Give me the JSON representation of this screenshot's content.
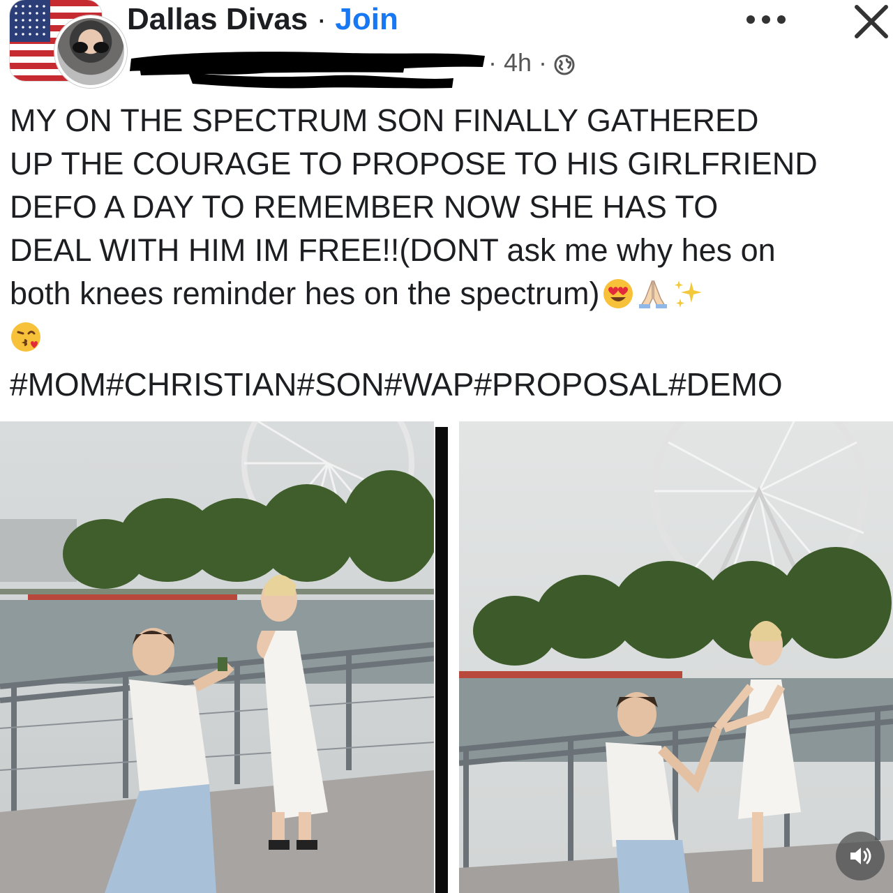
{
  "header": {
    "group_name": "Dallas Divas",
    "separator": " · ",
    "join_label": "Join",
    "time": "· 4h ·"
  },
  "post": {
    "body": "MY ON THE SPECTRUM SON FINALLY GATHERED\nUP THE COURAGE TO PROPOSE TO HIS GIRLFRIEND\nDEFO A DAY TO REMEMBER NOW SHE HAS TO\nDEAL WITH HIM IM FREE!!(DONT ask me why hes on\nboth knees reminder hes on the spectrum)",
    "emojis": [
      "heart-eyes-emoji",
      "praying-hands-emoji",
      "sparkles-emoji",
      "kissing-heart-emoji"
    ],
    "hashtags": "#MOM#CHRISTIAN#SON#WAP#PROPOSAL#DEMO"
  },
  "photos": [
    {
      "name": "proposal-photo-1"
    },
    {
      "name": "proposal-photo-2"
    }
  ],
  "icons": {
    "avatar_badge": "us-flag-icon",
    "privacy": "globe-icon",
    "menu": "more-options-icon",
    "dismiss": "close-icon",
    "audio": "speaker-icon"
  },
  "colors": {
    "link": "#1877f2",
    "text": "#1c1e21",
    "meta": "#555555"
  }
}
